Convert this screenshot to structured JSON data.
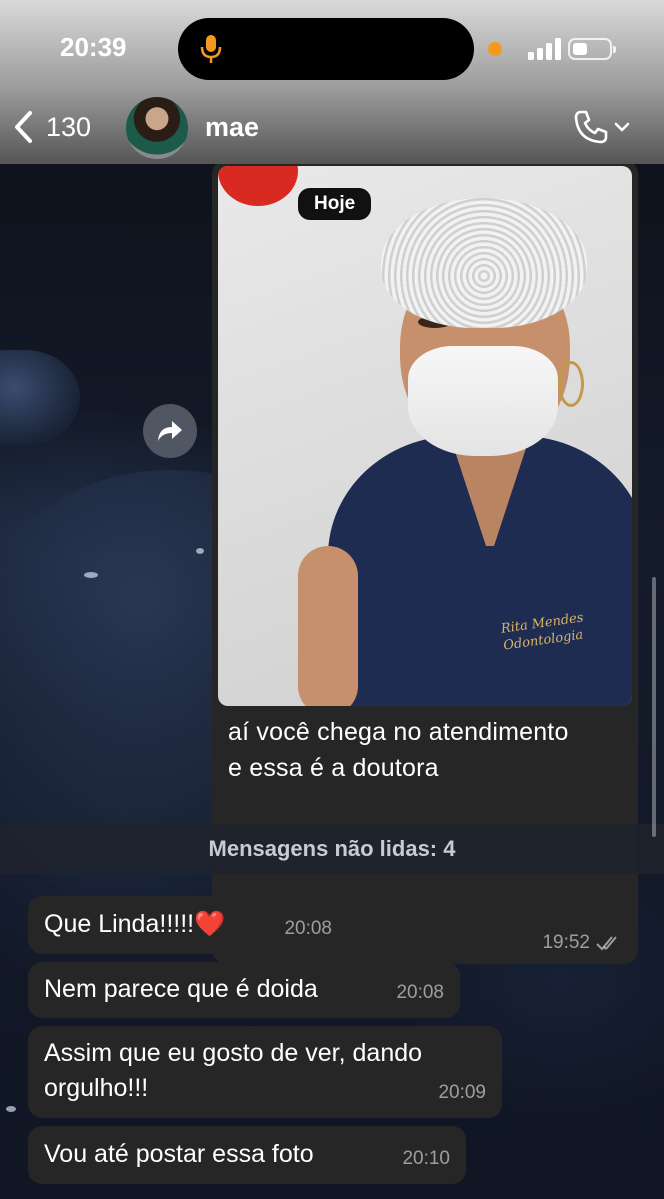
{
  "status_bar": {
    "time": "20:39"
  },
  "header": {
    "back_count": "130",
    "contact_name": "mae"
  },
  "image_message": {
    "date_pill": "Hoje",
    "embroidery_line1": "Rita Mendes",
    "embroidery_line2": "Odontologia",
    "caption_line1": "aí você chega no atendimento",
    "caption_line2": "e essa é a doutora",
    "time": "19:52",
    "status": "read"
  },
  "unread_banner": "Mensagens não lidas: 4",
  "messages": [
    {
      "text": "Que Linda!!!!!❤️",
      "time": "20:08"
    },
    {
      "text": "Nem parece que é  doida",
      "time": "20:08"
    },
    {
      "text_line1": "Assim que eu gosto de ver, dando",
      "text_line2": "orgulho!!!",
      "time": "20:09"
    },
    {
      "text": "Vou  até  postar essa foto",
      "time": "20:10"
    }
  ],
  "colors": {
    "bubble": "#262626",
    "header_gradient_top": "#d9d9d9",
    "recording_dot": "#f39a1e"
  },
  "icons": [
    "microphone-icon",
    "signal-icon",
    "battery-icon",
    "chevron-left-icon",
    "phone-icon",
    "chevron-down-icon",
    "forward-icon",
    "double-check-icon"
  ]
}
